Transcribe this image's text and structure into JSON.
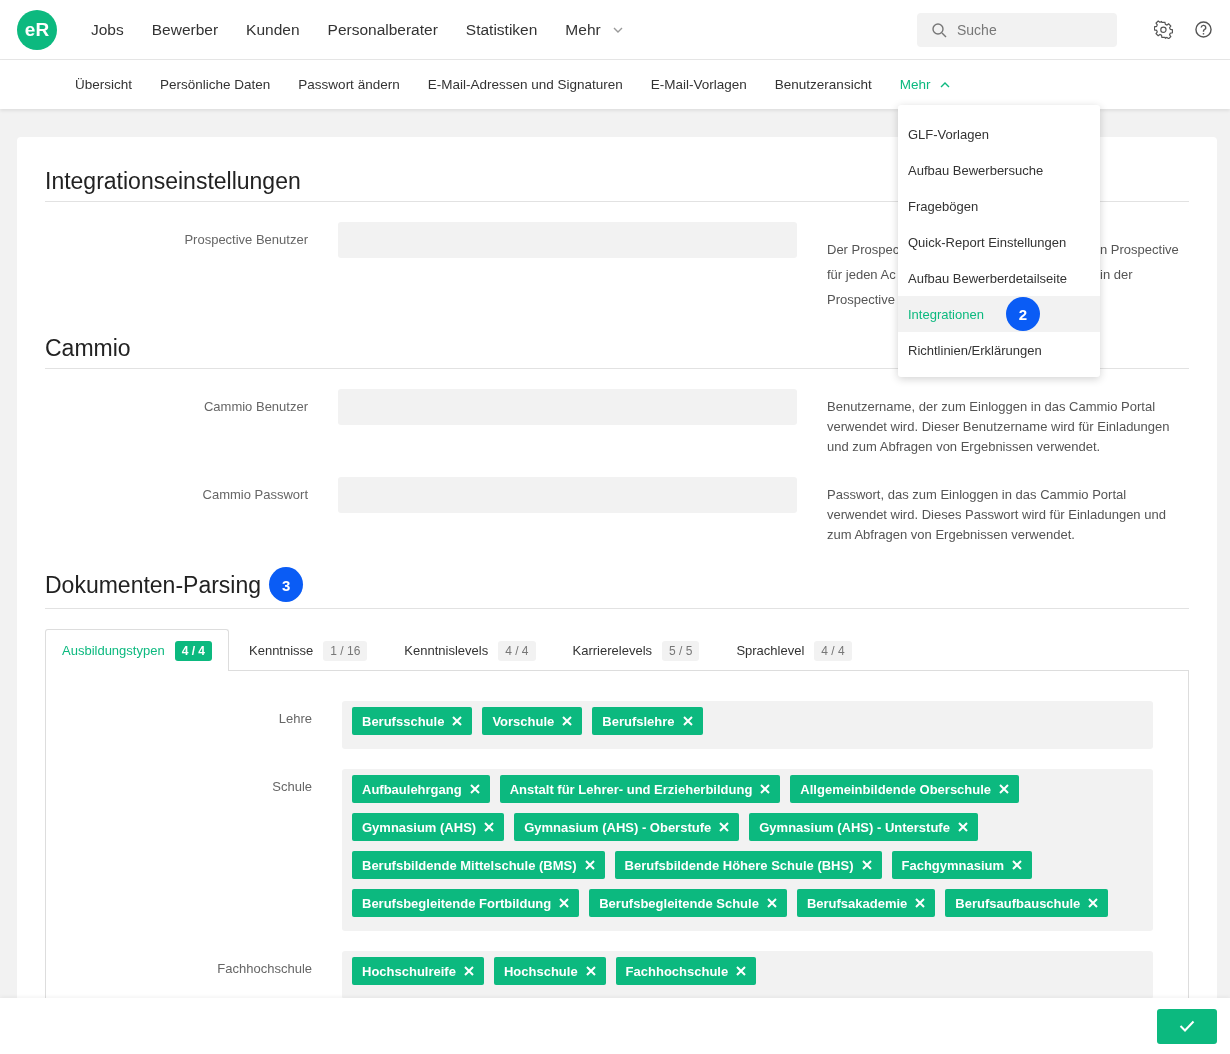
{
  "logo": {
    "text": "eR"
  },
  "main_nav": [
    {
      "label": "Jobs"
    },
    {
      "label": "Bewerber"
    },
    {
      "label": "Kunden"
    },
    {
      "label": "Personalberater"
    },
    {
      "label": "Statistiken"
    },
    {
      "label": "Mehr",
      "kind": "dropdown"
    }
  ],
  "search": {
    "placeholder": "Suche"
  },
  "sub_nav": [
    {
      "label": "Übersicht",
      "selected": false
    },
    {
      "label": "Persönliche Daten",
      "selected": false
    },
    {
      "label": "Passwort ändern",
      "selected": false
    },
    {
      "label": "E-Mail-Adressen und Signaturen",
      "selected": false
    },
    {
      "label": "E-Mail-Vorlagen",
      "selected": false
    },
    {
      "label": "Benutzeransicht",
      "selected": false
    },
    {
      "label": "Mehr",
      "selected": true,
      "kind": "dropdown",
      "expanded": true
    }
  ],
  "more_menu": [
    {
      "label": "GLF-Vorlagen",
      "selected": false
    },
    {
      "label": "Aufbau Bewerbersuche",
      "selected": false
    },
    {
      "label": "Fragebögen",
      "selected": false
    },
    {
      "label": "Quick-Report Einstellungen",
      "selected": false
    },
    {
      "label": "Aufbau Bewerberdetailseite",
      "selected": false
    },
    {
      "label": "Integrationen",
      "selected": true,
      "badge": "2"
    },
    {
      "label": "Richtlinien/Erklärungen",
      "selected": false
    }
  ],
  "sections": [
    {
      "title": "Integrationseinstellungen",
      "fields": [
        {
          "label": "Prospective Benutzer",
          "description_lines": [
            {
              "left": "Der Prospec",
              "right": "n Prospective"
            },
            {
              "left": "für jeden Ac",
              "right": "in der"
            },
            {
              "left": "Prospective"
            }
          ]
        }
      ]
    },
    {
      "title": "Cammio",
      "fields": [
        {
          "label": "Cammio Benutzer",
          "description": "Benutzername, der zum Einloggen in das Cammio Portal verwendet wird. Dieser Benutzername wird für Einladungen und zum Abfragen von Ergebnissen verwendet."
        },
        {
          "label": "Cammio Passwort",
          "description": "Passwort, das zum Einloggen in das Cammio Portal verwendet wird. Dieses Passwort wird für Einladungen und zum Abfragen von Ergebnissen verwendet."
        }
      ]
    }
  ],
  "parsing": {
    "title": "Dokumenten-Parsing",
    "badge": "3",
    "tabs": [
      {
        "label": "Ausbildungstypen",
        "count": "4 / 4",
        "selected": true
      },
      {
        "label": "Kenntnisse",
        "count": "1 / 16",
        "selected": false
      },
      {
        "label": "Kenntnislevels",
        "count": "4 / 4",
        "selected": false
      },
      {
        "label": "Karrierelevels",
        "count": "5 / 5",
        "selected": false
      },
      {
        "label": "Sprachlevel",
        "count": "4 / 4",
        "selected": false
      }
    ],
    "groups": [
      {
        "label": "Lehre",
        "tags": [
          "Berufsschule",
          "Vorschule",
          "Berufslehre"
        ]
      },
      {
        "label": "Schule",
        "tags": [
          "Aufbaulehrgang",
          "Anstalt für Lehrer- und Erzieherbildung",
          "Allgemeinbildende Oberschule",
          "Gymnasium (AHS)",
          "Gymnasium (AHS) - Oberstufe",
          "Gymnasium (AHS) - Unterstufe",
          "Berufsbildende Mittelschule (BMS)",
          "Berufsbildende Höhere Schule (BHS)",
          "Fachgymnasium",
          "Berufsbegleitende Fortbildung",
          "Berufsbegleitende Schule",
          "Berufsakademie",
          "Berufsaufbauschule"
        ]
      },
      {
        "label": "Fachhochschule",
        "tags": [
          "Hochschulreife",
          "Hochschule",
          "Fachhochschule"
        ]
      }
    ]
  }
}
